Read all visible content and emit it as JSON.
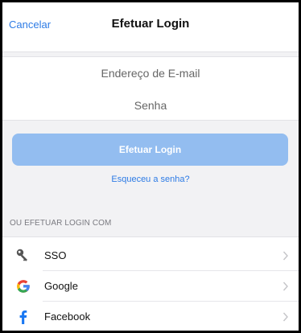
{
  "nav": {
    "cancel_label": "Cancelar",
    "title": "Efetuar Login"
  },
  "form": {
    "email_placeholder": "Endereço de E-mail",
    "password_placeholder": "Senha",
    "login_button": "Efetuar Login",
    "forgot_link": "Esqueceu a senha?"
  },
  "alt_login": {
    "header": "OU EFETUAR LOGIN COM",
    "options": [
      {
        "label": "SSO",
        "icon": "key-icon"
      },
      {
        "label": "Google",
        "icon": "google-icon"
      },
      {
        "label": "Facebook",
        "icon": "facebook-icon"
      }
    ]
  },
  "colors": {
    "accent": "#2d7be5",
    "button_disabled": "#93bdf0",
    "background": "#f2f2f4"
  }
}
